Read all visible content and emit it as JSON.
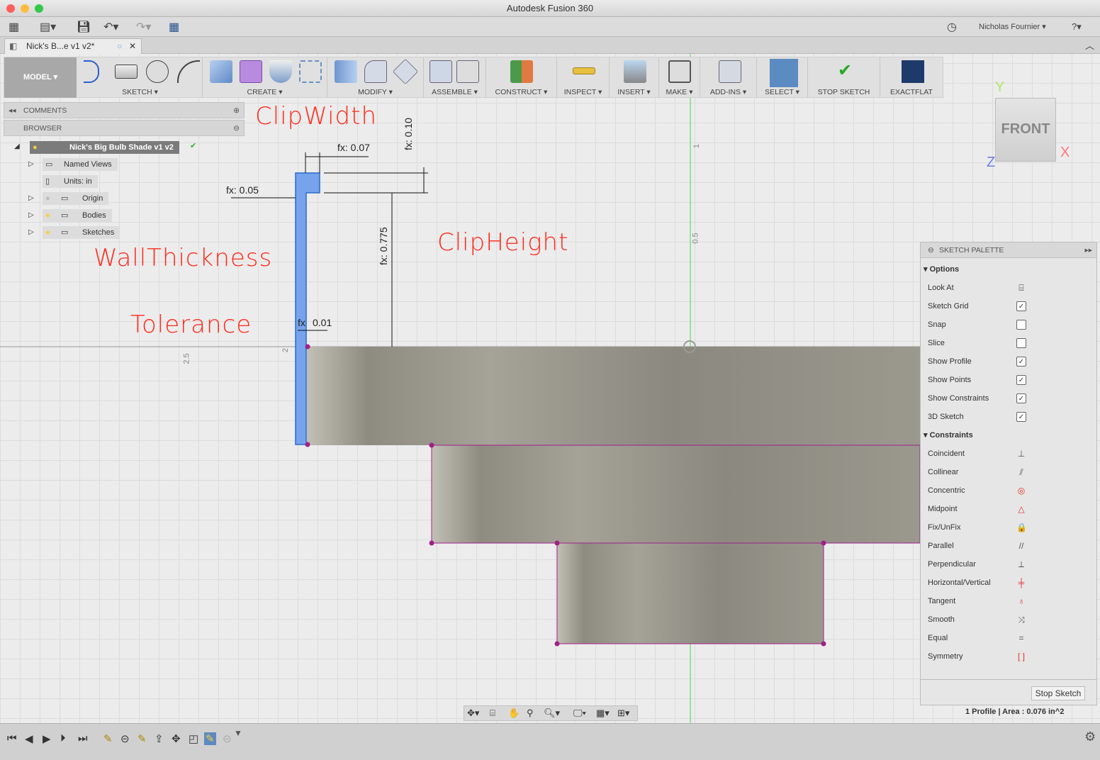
{
  "window": {
    "title": "Autodesk Fusion 360"
  },
  "app_toolbar": {
    "user": "Nicholas Fournier ▾",
    "help": "?▾"
  },
  "document_tab": {
    "label": "Nick's B...e v1 v2*"
  },
  "ribbon": {
    "workspace": "MODEL ▾",
    "groups": [
      {
        "label": "SKETCH ▾"
      },
      {
        "label": "CREATE ▾"
      },
      {
        "label": "MODIFY ▾"
      },
      {
        "label": "ASSEMBLE ▾"
      },
      {
        "label": "CONSTRUCT ▾"
      },
      {
        "label": "INSPECT ▾"
      },
      {
        "label": "INSERT ▾"
      },
      {
        "label": "MAKE ▾"
      },
      {
        "label": "ADD-INS ▾"
      },
      {
        "label": "SELECT ▾"
      },
      {
        "label": "STOP SKETCH"
      },
      {
        "label": "EXACTFLAT"
      }
    ]
  },
  "panels": {
    "comments": "COMMENTS",
    "browser": "BROWSER"
  },
  "browser": {
    "root": "Nick's Big Bulb Shade v1 v2",
    "items": [
      {
        "label": "Named Views"
      },
      {
        "label": "Units: in"
      },
      {
        "label": "Origin"
      },
      {
        "label": "Bodies"
      },
      {
        "label": "Sketches"
      }
    ]
  },
  "annotations": {
    "clip_width": "ClipWidth",
    "clip_height": "ClipHeight",
    "wall_thickness": "WallThickness",
    "tolerance": "Tolerance"
  },
  "dimensions": {
    "d1": "fx: 0.07",
    "d2": "fx: 0.10",
    "d3": "fx: 0.05",
    "d4": "fx: 0.775",
    "d5": "fx",
    "d5v": "0.01"
  },
  "axis_labels": {
    "a1": "1",
    "a2": "0.5",
    "a3": "2.5",
    "a4": "2"
  },
  "viewcube": {
    "face": "FRONT",
    "y": "Y",
    "x": "X",
    "z": "Z"
  },
  "palette": {
    "title": "SKETCH PALETTE",
    "options_header": "Options",
    "options": [
      {
        "label": "Look At",
        "icon": "look-at"
      },
      {
        "label": "Sketch Grid",
        "checked": true
      },
      {
        "label": "Snap",
        "checked": false
      },
      {
        "label": "Slice",
        "checked": false
      },
      {
        "label": "Show Profile",
        "checked": true
      },
      {
        "label": "Show Points",
        "checked": true
      },
      {
        "label": "Show Constraints",
        "checked": true
      },
      {
        "label": "3D Sketch",
        "checked": true
      }
    ],
    "constraints_header": "Constraints",
    "constraints": [
      {
        "label": "Coincident",
        "glyph": "⊥"
      },
      {
        "label": "Collinear",
        "glyph": "⫽"
      },
      {
        "label": "Concentric",
        "glyph": "◎"
      },
      {
        "label": "Midpoint",
        "glyph": "△"
      },
      {
        "label": "Fix/UnFix",
        "glyph": "🔒"
      },
      {
        "label": "Parallel",
        "glyph": "//"
      },
      {
        "label": "Perpendicular",
        "glyph": "⟂"
      },
      {
        "label": "Horizontal/Vertical",
        "glyph": "╪"
      },
      {
        "label": "Tangent",
        "glyph": "♁"
      },
      {
        "label": "Smooth",
        "glyph": "⤨"
      },
      {
        "label": "Equal",
        "glyph": "="
      },
      {
        "label": "Symmetry",
        "glyph": "[ ]"
      }
    ],
    "stop_button": "Stop Sketch"
  },
  "status": {
    "profile": "1 Profile | Area : 0.076 in^2"
  },
  "colors": {
    "accent_red": "#ff2a1a",
    "selection_blue": "#6f9ee8",
    "profile_line": "#a0208a",
    "axis_green": "#33cc33"
  }
}
